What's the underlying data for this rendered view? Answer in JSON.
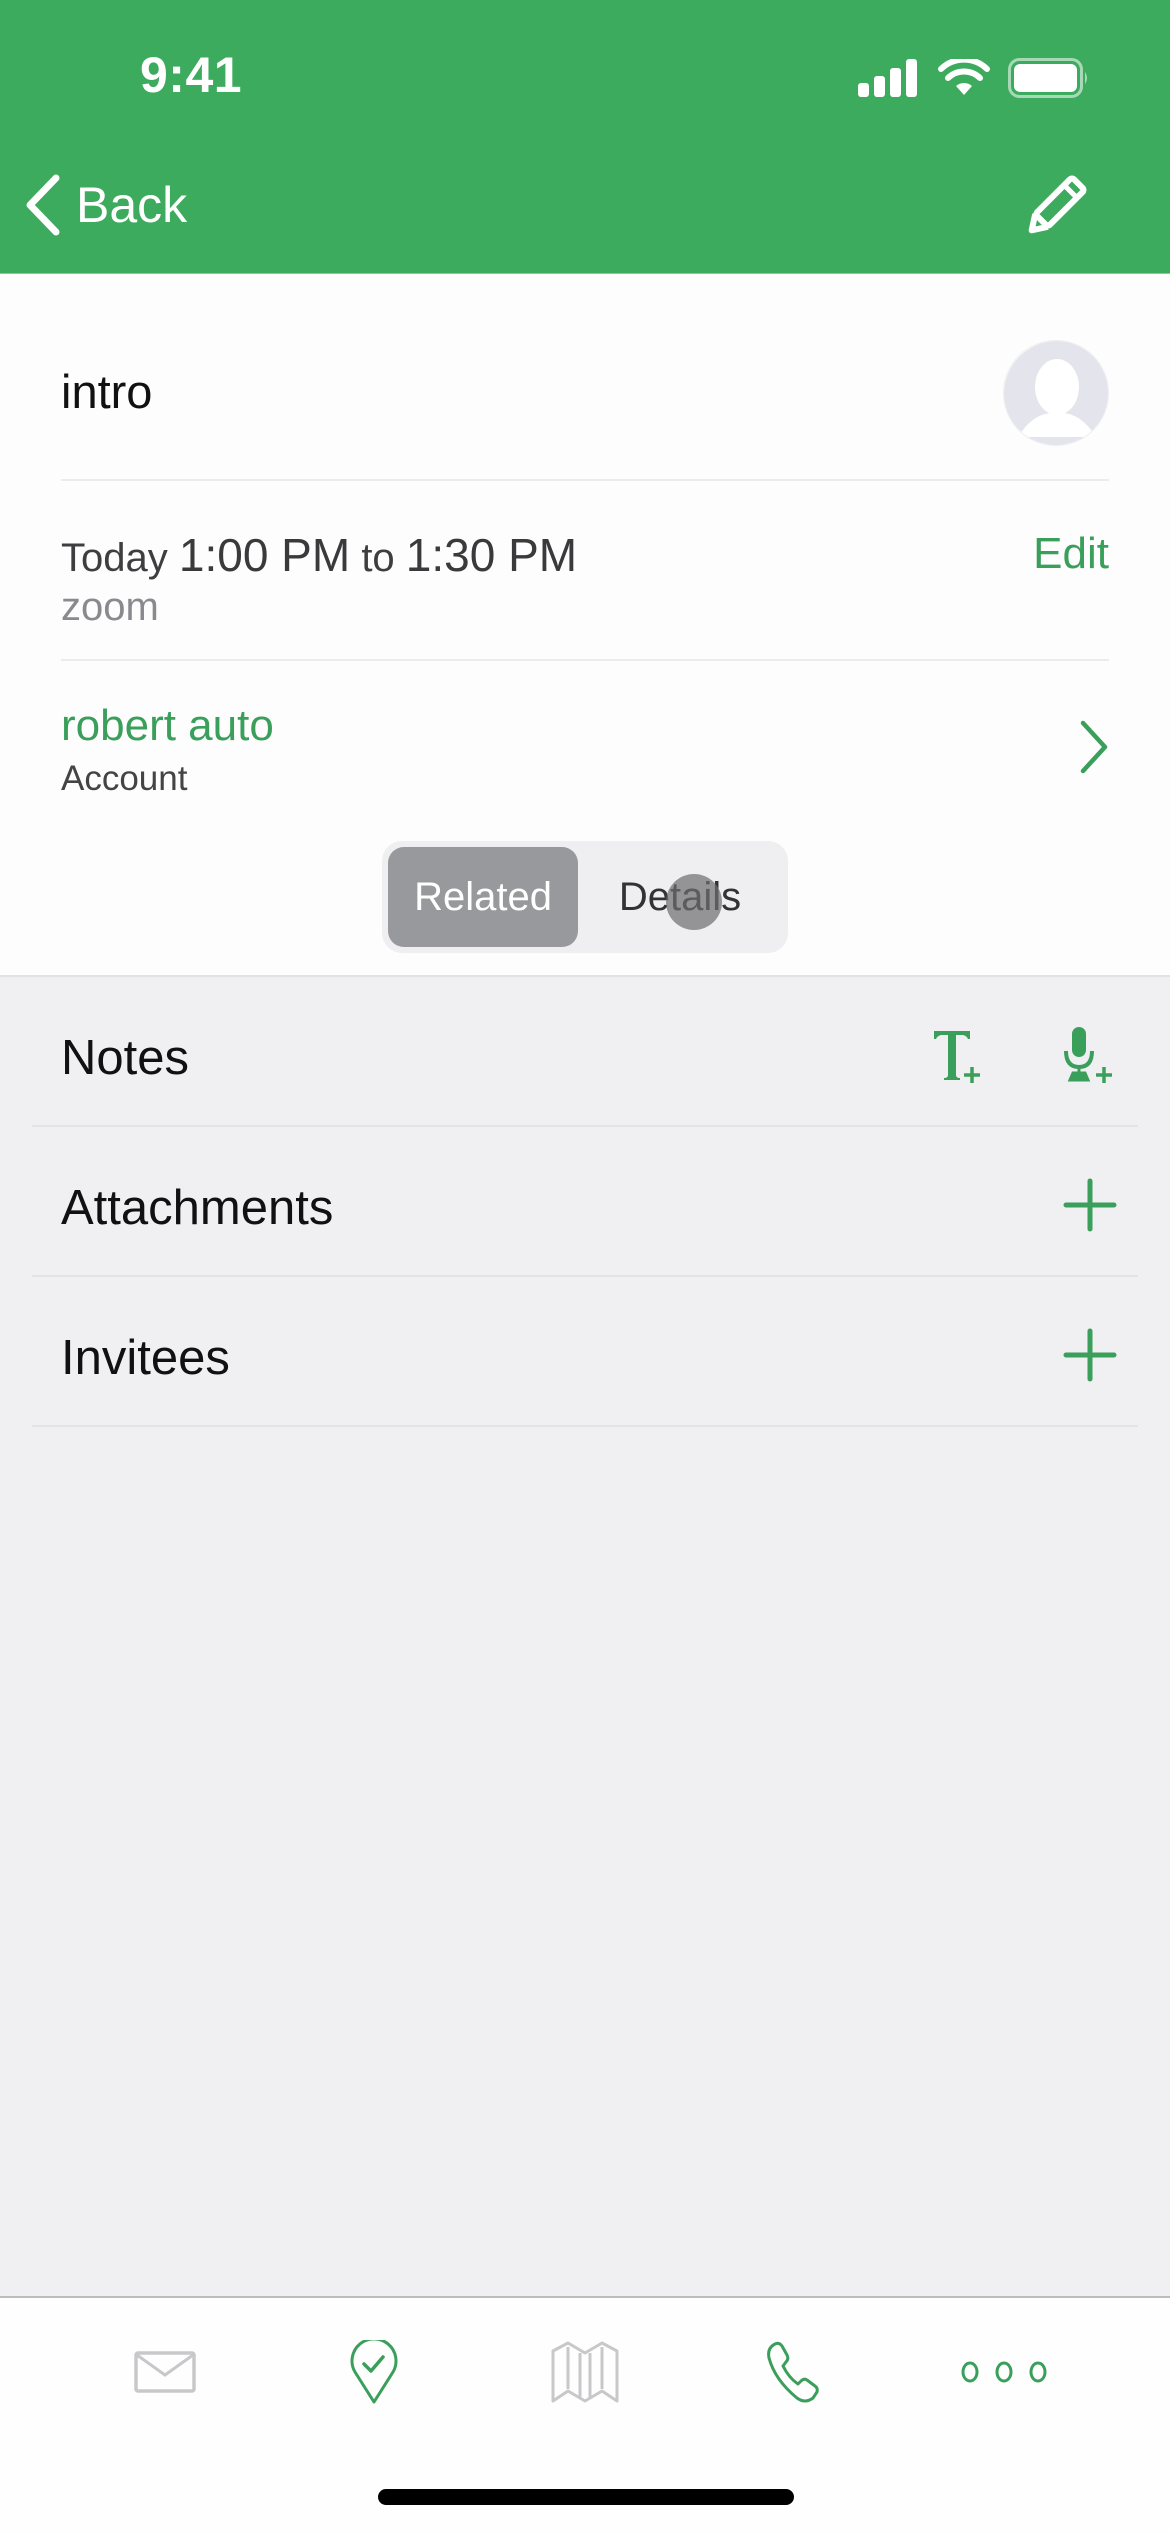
{
  "colors": {
    "brand_green": "#3dab5e",
    "accent_text_green": "#3a9f5b",
    "icon_inactive_grey": "#c8c8cb",
    "segment_active_grey": "#97999c"
  },
  "status_bar": {
    "time": "9:41",
    "icons": [
      "cellular-signal-icon",
      "wifi-icon",
      "battery-icon"
    ]
  },
  "nav": {
    "back_label": "Back",
    "right_icon": "pencil-icon"
  },
  "event": {
    "title": "intro",
    "avatar_icon": "person-placeholder-icon",
    "date_label": "Today",
    "start_time": "1:00 PM",
    "connector": "to",
    "end_time": "1:30 PM",
    "location": "zoom",
    "edit_label": "Edit"
  },
  "account": {
    "name": "robert auto",
    "type": "Account"
  },
  "segment": {
    "options": [
      {
        "label": "Related",
        "selected": true
      },
      {
        "label": "Details",
        "selected": false
      }
    ]
  },
  "sections": [
    {
      "label": "Notes",
      "actions": [
        "add-text-note-icon",
        "add-voice-note-icon"
      ]
    },
    {
      "label": "Attachments",
      "actions": [
        "plus-icon"
      ]
    },
    {
      "label": "Invitees",
      "actions": [
        "plus-icon"
      ]
    }
  ],
  "tabbar": {
    "tabs": [
      {
        "icon": "mail-icon",
        "enabled": false
      },
      {
        "icon": "location-check-icon",
        "enabled": true
      },
      {
        "icon": "map-icon",
        "enabled": false
      },
      {
        "icon": "phone-icon",
        "enabled": true
      },
      {
        "icon": "more-icon",
        "enabled": true
      }
    ]
  }
}
